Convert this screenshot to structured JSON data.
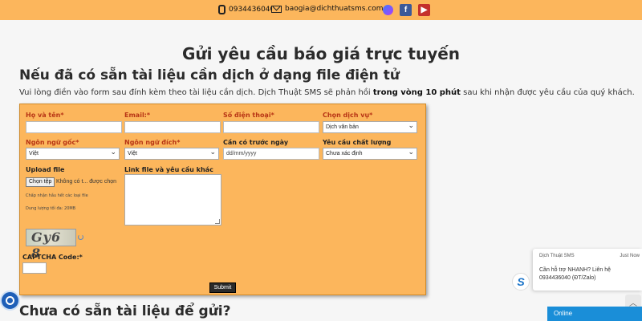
{
  "topbar": {
    "phone": "0934436040",
    "email": "baogia@dichthuatsms.com",
    "social_icons": [
      "messenger-icon",
      "facebook-icon",
      "youtube-icon"
    ],
    "bg_color": "#fcb65c"
  },
  "page": {
    "title": "Gửi yêu cầu báo giá trực tuyến",
    "section_title": "Nếu đã có sẵn tài liệu cần dịch ở dạng file điện tử",
    "intro_before": "Vui lòng điền vào form sau đính kèm theo tài liệu cần dịch. Dịch Thuật SMS sẽ phản hồi ",
    "intro_bold": "trong vòng 10 phút",
    "intro_after": " sau khi nhận được yêu cầu của quý khách.",
    "section2_title": "Chưa có sẵn tài liệu để gửi?"
  },
  "form": {
    "name_label": "Họ và tên*",
    "email_label": "Email:*",
    "phone_label": "Số điện thoại*",
    "service_label": "Chọn dịch vụ*",
    "service_value": "Dịch văn bản",
    "source_lang_label": "Ngôn ngữ gốc*",
    "source_lang_value": "Việt",
    "target_lang_label": "Ngôn ngữ đích*",
    "target_lang_value": "Việt",
    "deadline_label": "Cần có trước ngày",
    "deadline_placeholder": "dd/mm/yyyy",
    "quality_label": "Yêu cầu chất lượng",
    "quality_value": "Chưa xác định",
    "upload_label": "Upload file",
    "upload_button": "Chọn tệp",
    "upload_status": "Không có t... được chọn",
    "upload_note1": "Chấp nhận hầu hết các loại file",
    "upload_note2": "Dung lượng tối đa: 20MB",
    "link_label": "Link file và yêu cầu khác",
    "captcha_text": "Gy6 8",
    "captcha_label": "CAPTCHA Code:*",
    "submit_label": "Submit"
  },
  "chat": {
    "name": "Dịch Thuật SMS",
    "time": "Just Now",
    "message": "Cần hỗ trợ NHANH? Liên hệ 0934436040 (ĐT/Zalo)",
    "online_label": "Online"
  }
}
